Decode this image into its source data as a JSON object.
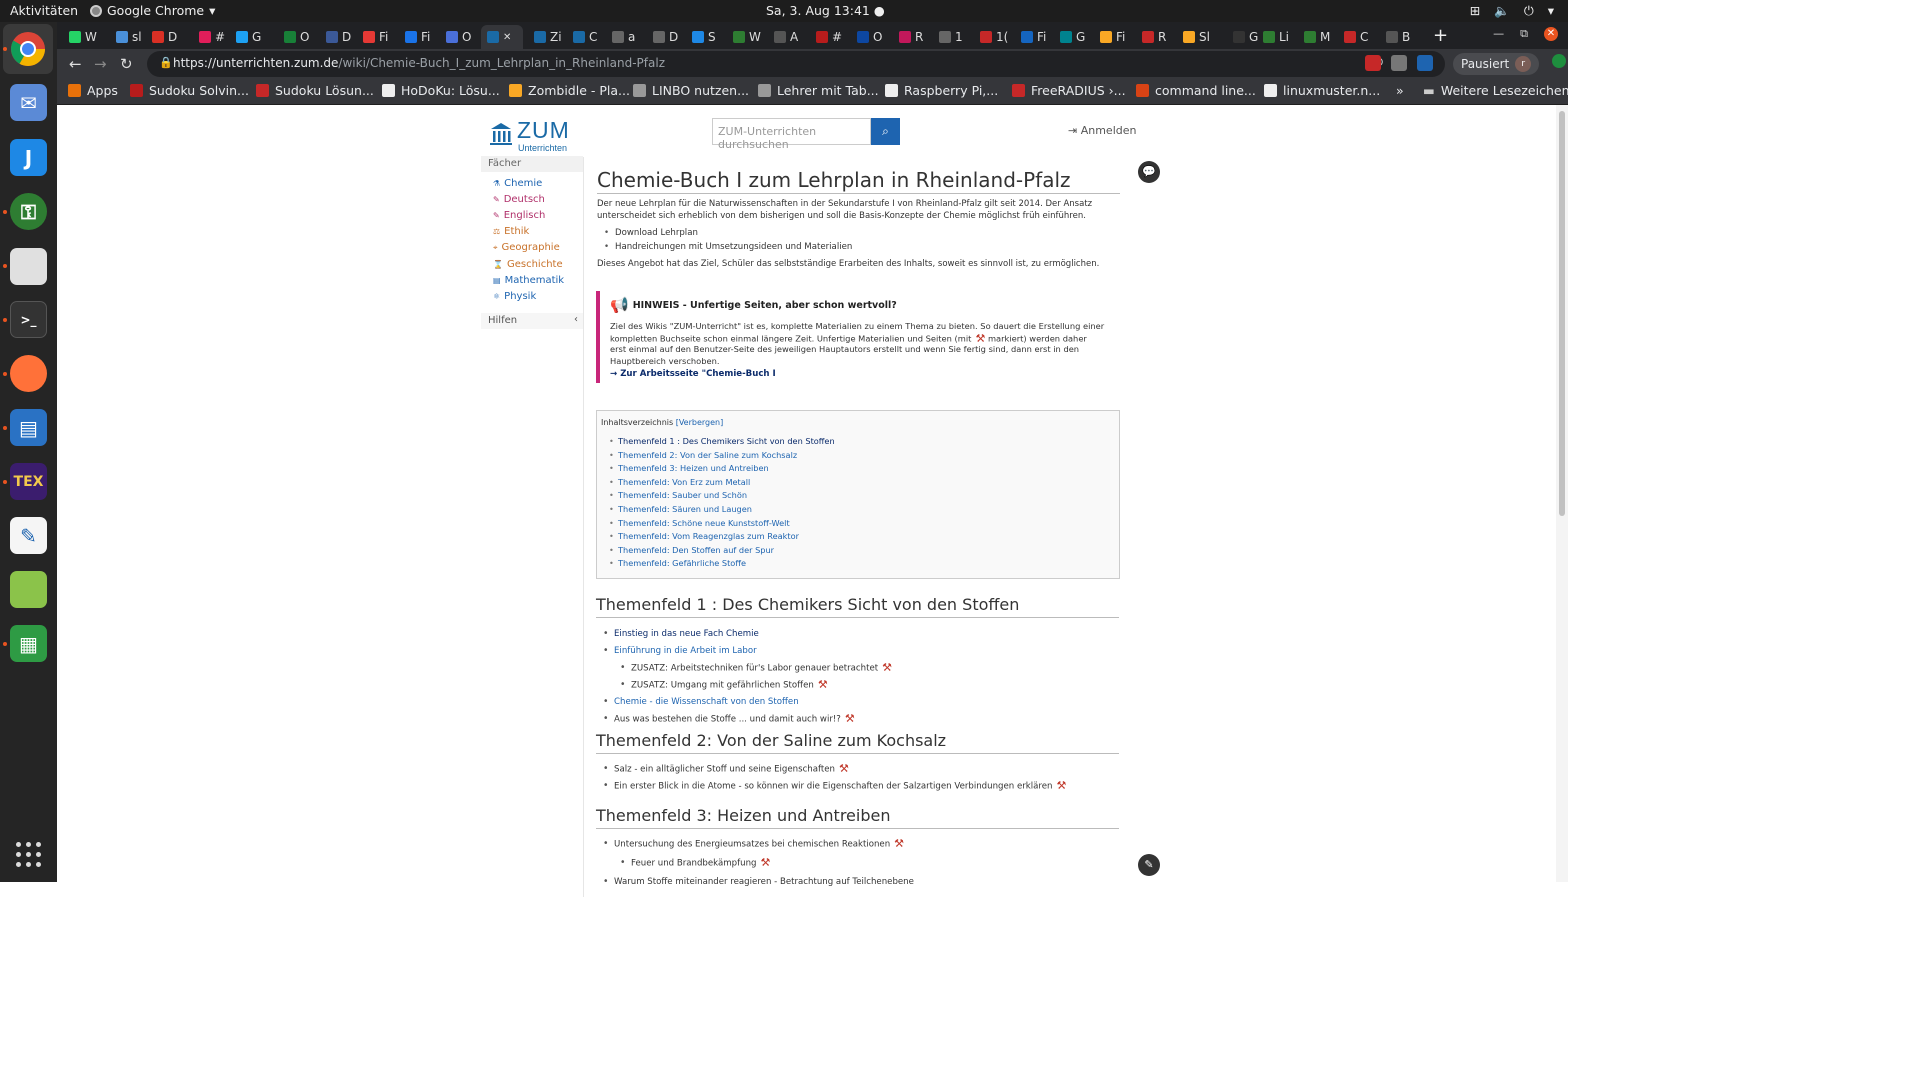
{
  "os": {
    "activities": "Aktivitäten",
    "app_name": "Google Chrome",
    "clock": "Sa, 3. Aug  13:41"
  },
  "tabs": [
    {
      "label": "W",
      "color": "#25d366"
    },
    {
      "label": "sl",
      "color": "#4a90d9"
    },
    {
      "label": "D",
      "color": "#d93025"
    },
    {
      "label": "#",
      "color": "#e01e5a"
    },
    {
      "label": "G",
      "color": "#1da1f2"
    },
    {
      "label": "O",
      "color": "#188038"
    },
    {
      "label": "D",
      "color": "#3b5998"
    },
    {
      "label": "Fi",
      "color": "#e53935"
    },
    {
      "label": "Fi",
      "color": "#1a73e8"
    },
    {
      "label": "O",
      "color": "#4a6fd9"
    },
    {
      "label": "Zi",
      "color": "#1a6aa6"
    },
    {
      "label": "C",
      "color": "#1a6aa6"
    },
    {
      "label": "a",
      "color": "#666"
    },
    {
      "label": "D",
      "color": "#666"
    },
    {
      "label": "S",
      "color": "#1e88e5"
    },
    {
      "label": "W",
      "color": "#2e7d32"
    },
    {
      "label": "A",
      "color": "#555"
    },
    {
      "label": "#",
      "color": "#b71c1c"
    },
    {
      "label": "O",
      "color": "#0d47a1"
    },
    {
      "label": "R",
      "color": "#c2185b"
    },
    {
      "label": "1",
      "color": "#666"
    },
    {
      "label": "1(",
      "color": "#c62828"
    },
    {
      "label": "Fi",
      "color": "#1565c0"
    },
    {
      "label": "G",
      "color": "#00838f"
    },
    {
      "label": "Fi",
      "color": "#f9a825"
    },
    {
      "label": "R",
      "color": "#c62828"
    },
    {
      "label": "Sl",
      "color": "#f9a825"
    },
    {
      "label": "G",
      "color": "#333"
    },
    {
      "label": "Li",
      "color": "#2e7d32"
    },
    {
      "label": "M",
      "color": "#2e7d32"
    },
    {
      "label": "C",
      "color": "#c62828"
    },
    {
      "label": "B",
      "color": "#555"
    }
  ],
  "active_tab_label": "",
  "address_bar": {
    "url_domain": "https://unterrichten.zum.de",
    "url_path": "/wiki/Chemie-Buch_I_zum_Lehrplan_in_Rheinland-Pfalz"
  },
  "profile": {
    "label": "Pausiert",
    "avatar": "r"
  },
  "bookmarks": [
    {
      "label": "Apps",
      "color": "#e8710a"
    },
    {
      "label": "Sudoku Solvin...",
      "color": "#b71c1c"
    },
    {
      "label": "Sudoku Lösun...",
      "color": "#c62828"
    },
    {
      "label": "HoDoKu: Lösu...",
      "color": "#eee"
    },
    {
      "label": "Zombidle - Pla...",
      "color": "#f9a825"
    },
    {
      "label": "LINBO nutzen...",
      "color": "#999"
    },
    {
      "label": "Lehrer mit Tab...",
      "color": "#999"
    },
    {
      "label": "Raspberry Pi,...",
      "color": "#eee"
    },
    {
      "label": "FreeRADIUS ›...",
      "color": "#c62828"
    },
    {
      "label": "command line...",
      "color": "#d84315"
    },
    {
      "label": "linuxmuster.n...",
      "color": "#eee"
    }
  ],
  "bookmarks_more": "»",
  "bookmarks_folder": "Weitere Lesezeichen",
  "site": {
    "logo_text": "ZUM",
    "logo_sub": "Unterrichten",
    "search_placeholder": "ZUM-Unterrichten durchsuchen",
    "login": "Anmelden"
  },
  "sidebar": {
    "heading": "Fächer",
    "items": [
      {
        "label": "Chemie",
        "color": "#1e64b0"
      },
      {
        "label": "Deutsch",
        "color": "#b0306a"
      },
      {
        "label": "Englisch",
        "color": "#b0306a"
      },
      {
        "label": "Ethik",
        "color": "#c8722a"
      },
      {
        "label": "Geographie",
        "color": "#c8722a"
      },
      {
        "label": "Geschichte",
        "color": "#c8722a"
      },
      {
        "label": "Mathematik",
        "color": "#1e64b0"
      },
      {
        "label": "Physik",
        "color": "#1e64b0"
      }
    ],
    "help": "Hilfen"
  },
  "article": {
    "title": "Chemie-Buch I zum Lehrplan in Rheinland-Pfalz",
    "intro": "Der neue Lehrplan für die Naturwissenschaften in der Sekundarstufe I von Rheinland-Pfalz gilt seit 2014. Der Ansatz unterscheidet sich erheblich von dem bisherigen und soll die Basis-Konzepte der Chemie möglichst früh einführen.",
    "links": [
      "Download Lehrplan",
      "Handreichungen mit Umsetzungsideen und Materialien"
    ],
    "goal": "Dieses Angebot hat das Ziel, Schüler das selbstständige Erarbeiten des Inhalts, soweit es sinnvoll ist, zu ermöglichen.",
    "notice_title": "HINWEIS - Unfertige Seiten, aber schon wertvoll?",
    "notice_text_1": "Ziel des Wikis \"ZUM-Unterricht\" ist es, komplette Materialien zu einem Thema zu bieten. So dauert die Erstellung einer kompletten Buchseite schon einmal längere Zeit. Unfertige Materialien und Seiten (mit",
    "notice_text_2": "markiert) werden daher erst einmal auf den Benutzer-Seite des jeweiligen Hauptautors erstellt und wenn Sie fertig sind, dann erst in den Hauptbereich verschoben.",
    "notice_link": "→ Zur Arbeitsseite \"Chemie-Buch I",
    "toc_title": "Inhaltsverzeichnis",
    "toc_hide": "[Verbergen]",
    "toc": [
      "Themenfeld 1 : Des Chemikers Sicht von den Stoffen",
      "Themenfeld 2: Von der Saline zum Kochsalz",
      "Themenfeld 3: Heizen und Antreiben",
      "Themenfeld: Von Erz zum Metall",
      "Themenfeld: Sauber und Schön",
      "Themenfeld: Säuren und Laugen",
      "Themenfeld: Schöne neue Kunststoff-Welt",
      "Themenfeld: Vom Reagenzglas zum Reaktor",
      "Themenfeld: Den Stoffen auf der Spur",
      "Themenfeld: Gefährliche Stoffe"
    ],
    "sec1": {
      "title": "Themenfeld 1 : Des Chemikers Sicht von den Stoffen",
      "items": [
        "Einstieg in das neue Fach Chemie",
        "Einführung in die Arbeit im Labor",
        "ZUSATZ: Arbeitstechniken für's Labor genauer betrachtet",
        "ZUSATZ: Umgang mit gefährlichen Stoffen",
        "Chemie - die Wissenschaft von den Stoffen",
        "Aus was bestehen die Stoffe ... und damit auch wir!?"
      ]
    },
    "sec2": {
      "title": "Themenfeld 2: Von der Saline zum Kochsalz",
      "items": [
        "Salz - ein alltäglicher Stoff und seine Eigenschaften",
        "Ein erster Blick in die Atome - so können wir die Eigenschaften der Salzartigen Verbindungen erklären"
      ]
    },
    "sec3": {
      "title": "Themenfeld 3: Heizen und Antreiben",
      "items": [
        "Untersuchung des Energieumsatzes bei chemischen Reaktionen",
        "Feuer und Brandbekämpfung",
        "Warum Stoffe miteinander reagieren - Betrachtung auf Teilchenebene"
      ]
    }
  }
}
